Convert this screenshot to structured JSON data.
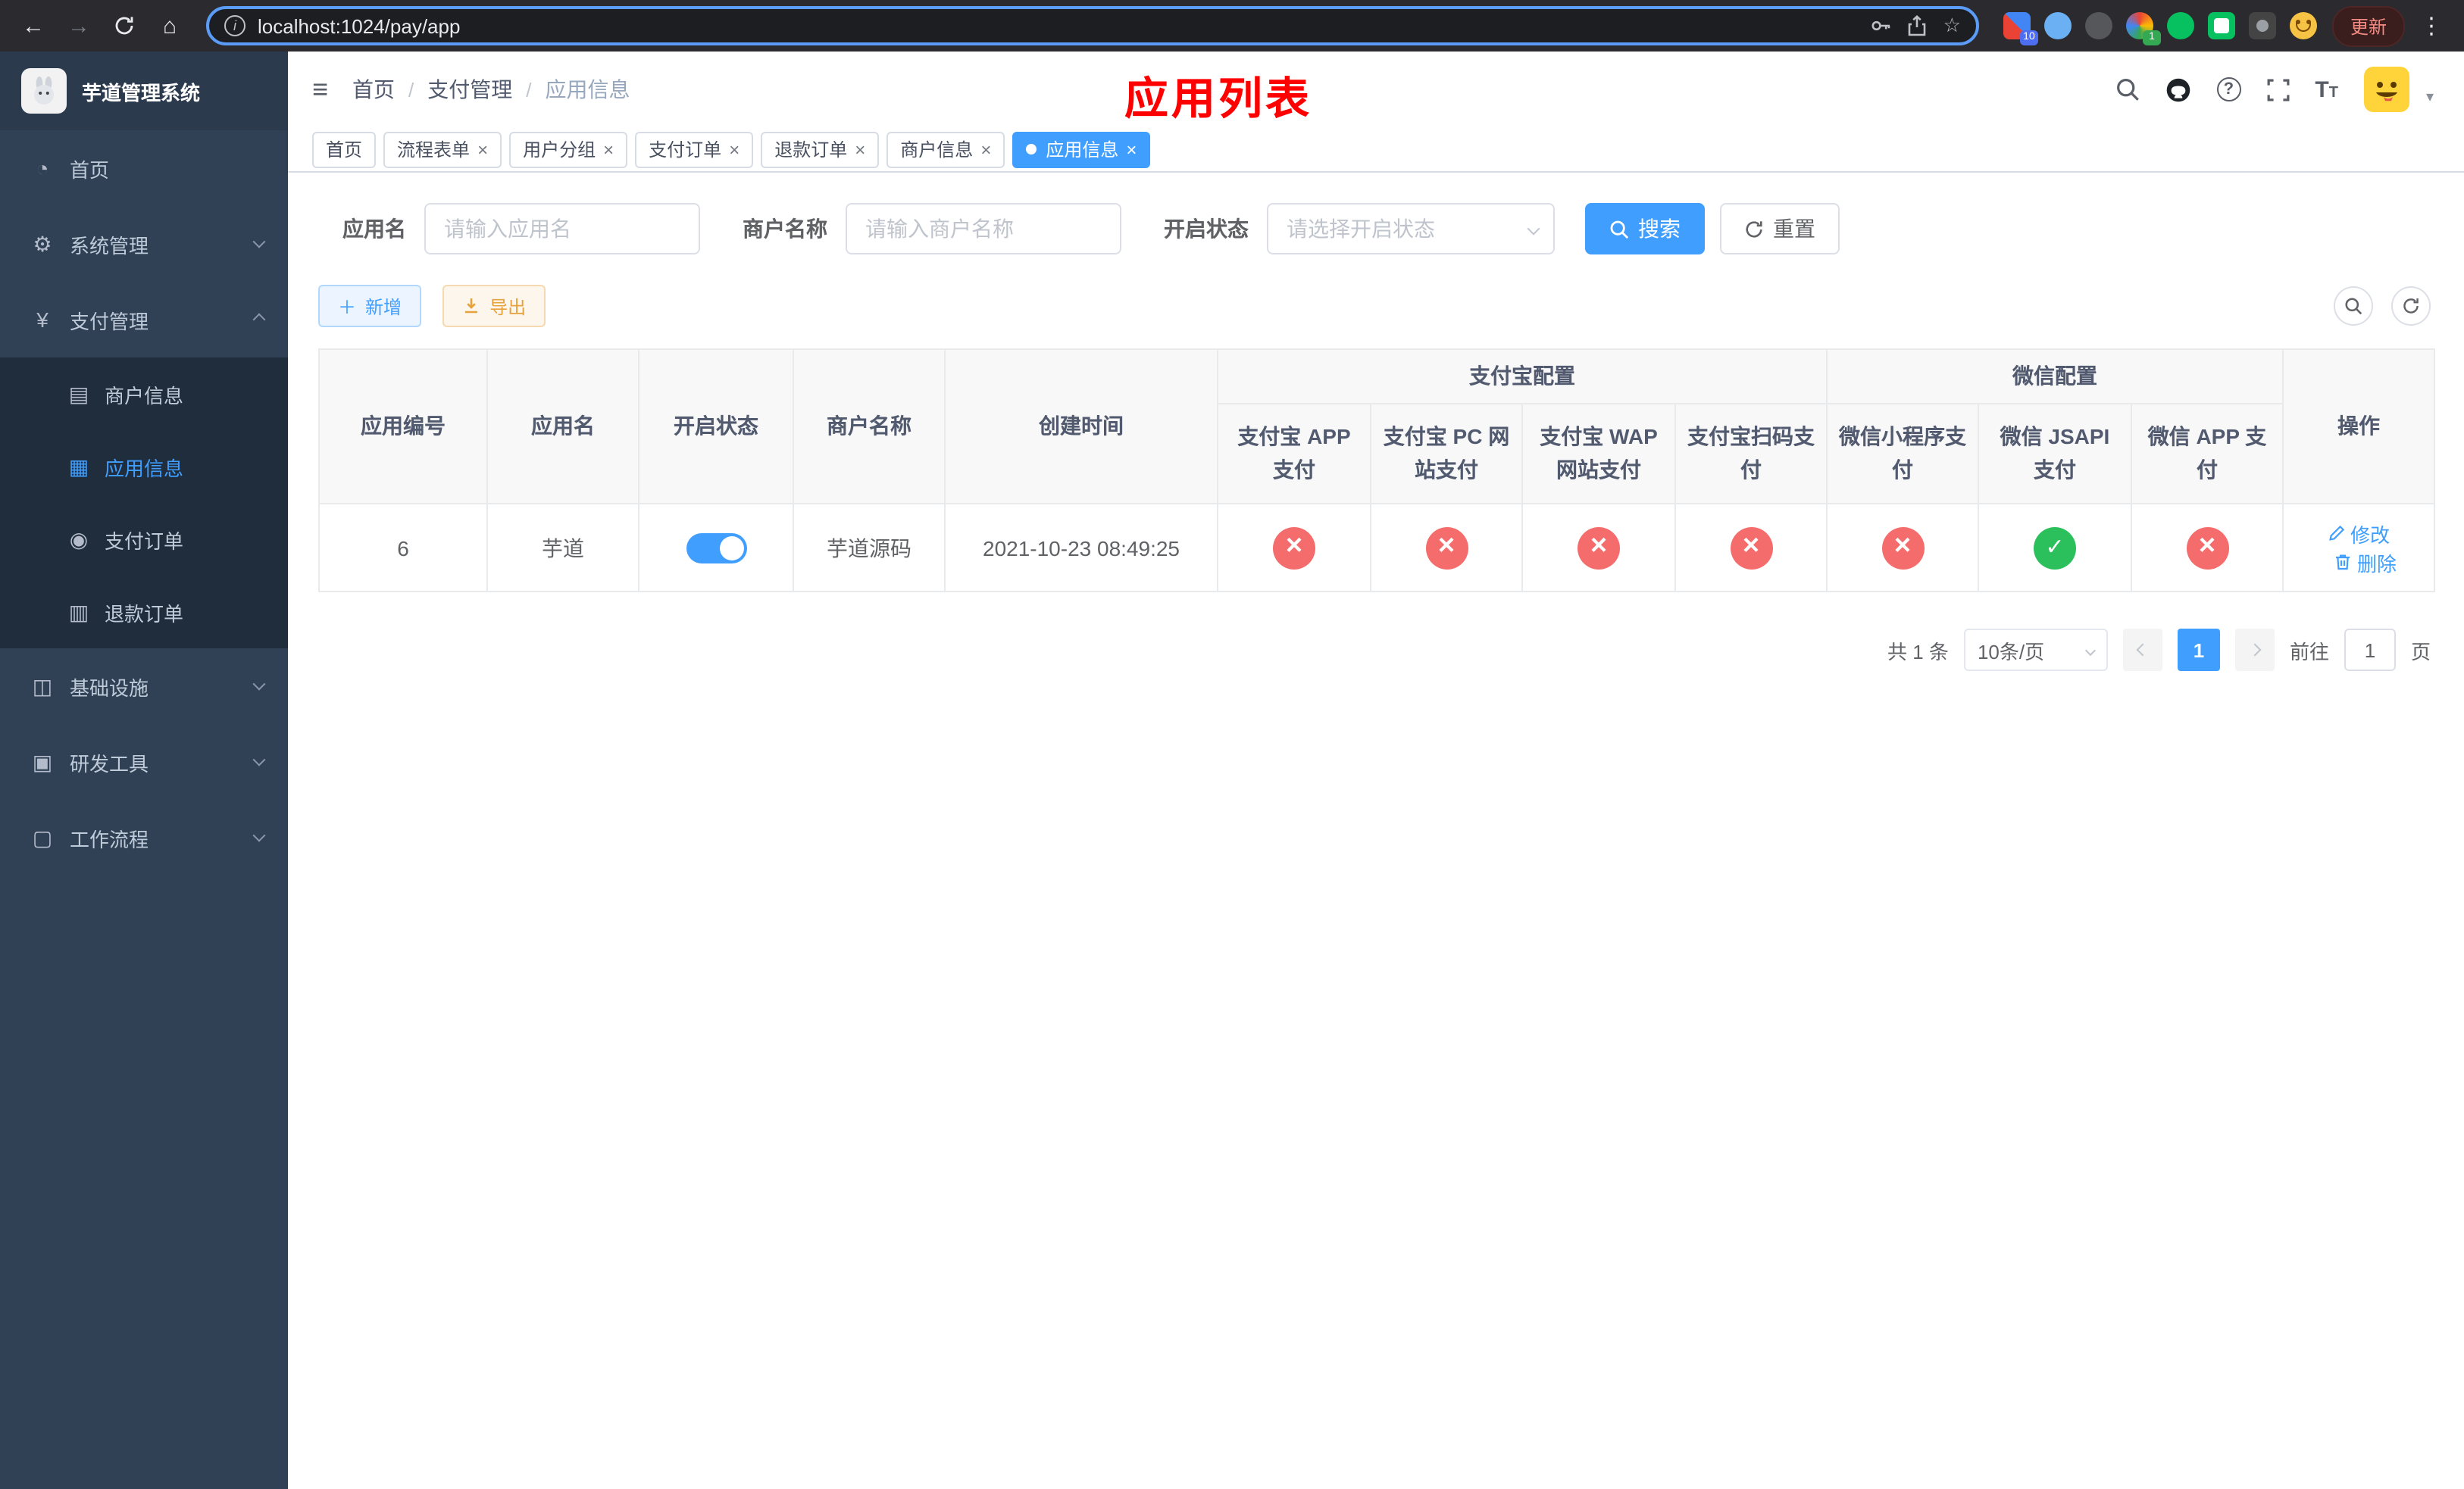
{
  "colors": {
    "primary": "#409eff",
    "danger": "#f56c6c",
    "success": "#2bc05c",
    "title_red": "#ff0000",
    "warning": "#e6a23c"
  },
  "browser": {
    "url": "localhost:1024/pay/app",
    "update_button": "更新",
    "extension_badge_grid": "10",
    "extension_badge_colorful": "1"
  },
  "sidebar": {
    "logo_title": "芋道管理系统",
    "items": [
      {
        "label": "首页"
      },
      {
        "label": "系统管理"
      },
      {
        "label": "支付管理"
      },
      {
        "label": "基础设施"
      },
      {
        "label": "研发工具"
      },
      {
        "label": "工作流程"
      }
    ],
    "pay_submenu": [
      {
        "label": "商户信息"
      },
      {
        "label": "应用信息"
      },
      {
        "label": "支付订单"
      },
      {
        "label": "退款订单"
      }
    ]
  },
  "navbar": {
    "breadcrumb": [
      "首页",
      "支付管理",
      "应用信息"
    ],
    "page_title": "应用列表"
  },
  "tabs": [
    {
      "label": "首页"
    },
    {
      "label": "流程表单"
    },
    {
      "label": "用户分组"
    },
    {
      "label": "支付订单"
    },
    {
      "label": "退款订单"
    },
    {
      "label": "商户信息"
    },
    {
      "label": "应用信息"
    }
  ],
  "filters": {
    "app_name_label": "应用名",
    "app_name_placeholder": "请输入应用名",
    "merchant_label": "商户名称",
    "merchant_placeholder": "请输入商户名称",
    "status_label": "开启状态",
    "status_placeholder": "请选择开启状态",
    "search_button": "搜索",
    "reset_button": "重置"
  },
  "toolbar": {
    "add_button": "新增",
    "export_button": "导出"
  },
  "table": {
    "headers": {
      "app_id": "应用编号",
      "app_name": "应用名",
      "status": "开启状态",
      "merchant": "商户名称",
      "created": "创建时间",
      "alipay_group": "支付宝配置",
      "wechat_group": "微信配置",
      "alipay_app": "支付宝 APP 支付",
      "alipay_pc": "支付宝 PC 网站支付",
      "alipay_wap": "支付宝 WAP 网站支付",
      "alipay_qr": "支付宝扫码支付",
      "wechat_mini": "微信小程序支付",
      "wechat_jsapi": "微信 JSAPI 支付",
      "wechat_app": "微信 APP 支付",
      "actions": "操作"
    },
    "rows": [
      {
        "app_id": "6",
        "app_name": "芋道",
        "status_on": true,
        "merchant": "芋道源码",
        "created": "2021-10-23 08:49:25",
        "configs": {
          "alipay_app": false,
          "alipay_pc": false,
          "alipay_wap": false,
          "alipay_qr": false,
          "wechat_mini": false,
          "wechat_jsapi": true,
          "wechat_app": false
        },
        "edit_label": "修改",
        "delete_label": "删除"
      }
    ]
  },
  "pagination": {
    "total_text": "共 1 条",
    "page_size": "10条/页",
    "page": "1",
    "goto_prefix": "前往",
    "goto_value": "1",
    "goto_suffix": "页"
  }
}
